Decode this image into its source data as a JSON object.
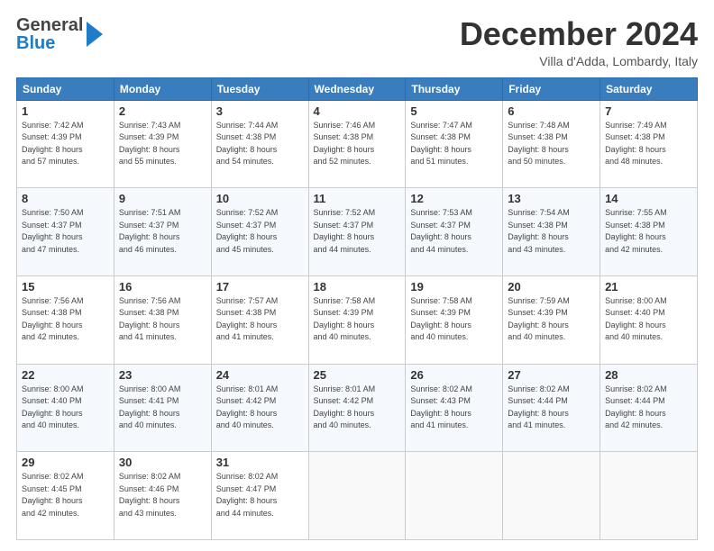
{
  "header": {
    "logo_general": "General",
    "logo_blue": "Blue",
    "month_title": "December 2024",
    "location": "Villa d'Adda, Lombardy, Italy"
  },
  "weekdays": [
    "Sunday",
    "Monday",
    "Tuesday",
    "Wednesday",
    "Thursday",
    "Friday",
    "Saturday"
  ],
  "weeks": [
    [
      {
        "day": "1",
        "sunrise": "Sunrise: 7:42 AM",
        "sunset": "Sunset: 4:39 PM",
        "daylight": "Daylight: 8 hours and 57 minutes."
      },
      {
        "day": "2",
        "sunrise": "Sunrise: 7:43 AM",
        "sunset": "Sunset: 4:39 PM",
        "daylight": "Daylight: 8 hours and 55 minutes."
      },
      {
        "day": "3",
        "sunrise": "Sunrise: 7:44 AM",
        "sunset": "Sunset: 4:38 PM",
        "daylight": "Daylight: 8 hours and 54 minutes."
      },
      {
        "day": "4",
        "sunrise": "Sunrise: 7:46 AM",
        "sunset": "Sunset: 4:38 PM",
        "daylight": "Daylight: 8 hours and 52 minutes."
      },
      {
        "day": "5",
        "sunrise": "Sunrise: 7:47 AM",
        "sunset": "Sunset: 4:38 PM",
        "daylight": "Daylight: 8 hours and 51 minutes."
      },
      {
        "day": "6",
        "sunrise": "Sunrise: 7:48 AM",
        "sunset": "Sunset: 4:38 PM",
        "daylight": "Daylight: 8 hours and 50 minutes."
      },
      {
        "day": "7",
        "sunrise": "Sunrise: 7:49 AM",
        "sunset": "Sunset: 4:38 PM",
        "daylight": "Daylight: 8 hours and 48 minutes."
      }
    ],
    [
      {
        "day": "8",
        "sunrise": "Sunrise: 7:50 AM",
        "sunset": "Sunset: 4:37 PM",
        "daylight": "Daylight: 8 hours and 47 minutes."
      },
      {
        "day": "9",
        "sunrise": "Sunrise: 7:51 AM",
        "sunset": "Sunset: 4:37 PM",
        "daylight": "Daylight: 8 hours and 46 minutes."
      },
      {
        "day": "10",
        "sunrise": "Sunrise: 7:52 AM",
        "sunset": "Sunset: 4:37 PM",
        "daylight": "Daylight: 8 hours and 45 minutes."
      },
      {
        "day": "11",
        "sunrise": "Sunrise: 7:52 AM",
        "sunset": "Sunset: 4:37 PM",
        "daylight": "Daylight: 8 hours and 44 minutes."
      },
      {
        "day": "12",
        "sunrise": "Sunrise: 7:53 AM",
        "sunset": "Sunset: 4:37 PM",
        "daylight": "Daylight: 8 hours and 44 minutes."
      },
      {
        "day": "13",
        "sunrise": "Sunrise: 7:54 AM",
        "sunset": "Sunset: 4:38 PM",
        "daylight": "Daylight: 8 hours and 43 minutes."
      },
      {
        "day": "14",
        "sunrise": "Sunrise: 7:55 AM",
        "sunset": "Sunset: 4:38 PM",
        "daylight": "Daylight: 8 hours and 42 minutes."
      }
    ],
    [
      {
        "day": "15",
        "sunrise": "Sunrise: 7:56 AM",
        "sunset": "Sunset: 4:38 PM",
        "daylight": "Daylight: 8 hours and 42 minutes."
      },
      {
        "day": "16",
        "sunrise": "Sunrise: 7:56 AM",
        "sunset": "Sunset: 4:38 PM",
        "daylight": "Daylight: 8 hours and 41 minutes."
      },
      {
        "day": "17",
        "sunrise": "Sunrise: 7:57 AM",
        "sunset": "Sunset: 4:38 PM",
        "daylight": "Daylight: 8 hours and 41 minutes."
      },
      {
        "day": "18",
        "sunrise": "Sunrise: 7:58 AM",
        "sunset": "Sunset: 4:39 PM",
        "daylight": "Daylight: 8 hours and 40 minutes."
      },
      {
        "day": "19",
        "sunrise": "Sunrise: 7:58 AM",
        "sunset": "Sunset: 4:39 PM",
        "daylight": "Daylight: 8 hours and 40 minutes."
      },
      {
        "day": "20",
        "sunrise": "Sunrise: 7:59 AM",
        "sunset": "Sunset: 4:39 PM",
        "daylight": "Daylight: 8 hours and 40 minutes."
      },
      {
        "day": "21",
        "sunrise": "Sunrise: 8:00 AM",
        "sunset": "Sunset: 4:40 PM",
        "daylight": "Daylight: 8 hours and 40 minutes."
      }
    ],
    [
      {
        "day": "22",
        "sunrise": "Sunrise: 8:00 AM",
        "sunset": "Sunset: 4:40 PM",
        "daylight": "Daylight: 8 hours and 40 minutes."
      },
      {
        "day": "23",
        "sunrise": "Sunrise: 8:00 AM",
        "sunset": "Sunset: 4:41 PM",
        "daylight": "Daylight: 8 hours and 40 minutes."
      },
      {
        "day": "24",
        "sunrise": "Sunrise: 8:01 AM",
        "sunset": "Sunset: 4:42 PM",
        "daylight": "Daylight: 8 hours and 40 minutes."
      },
      {
        "day": "25",
        "sunrise": "Sunrise: 8:01 AM",
        "sunset": "Sunset: 4:42 PM",
        "daylight": "Daylight: 8 hours and 40 minutes."
      },
      {
        "day": "26",
        "sunrise": "Sunrise: 8:02 AM",
        "sunset": "Sunset: 4:43 PM",
        "daylight": "Daylight: 8 hours and 41 minutes."
      },
      {
        "day": "27",
        "sunrise": "Sunrise: 8:02 AM",
        "sunset": "Sunset: 4:44 PM",
        "daylight": "Daylight: 8 hours and 41 minutes."
      },
      {
        "day": "28",
        "sunrise": "Sunrise: 8:02 AM",
        "sunset": "Sunset: 4:44 PM",
        "daylight": "Daylight: 8 hours and 42 minutes."
      }
    ],
    [
      {
        "day": "29",
        "sunrise": "Sunrise: 8:02 AM",
        "sunset": "Sunset: 4:45 PM",
        "daylight": "Daylight: 8 hours and 42 minutes."
      },
      {
        "day": "30",
        "sunrise": "Sunrise: 8:02 AM",
        "sunset": "Sunset: 4:46 PM",
        "daylight": "Daylight: 8 hours and 43 minutes."
      },
      {
        "day": "31",
        "sunrise": "Sunrise: 8:02 AM",
        "sunset": "Sunset: 4:47 PM",
        "daylight": "Daylight: 8 hours and 44 minutes."
      },
      null,
      null,
      null,
      null
    ]
  ]
}
